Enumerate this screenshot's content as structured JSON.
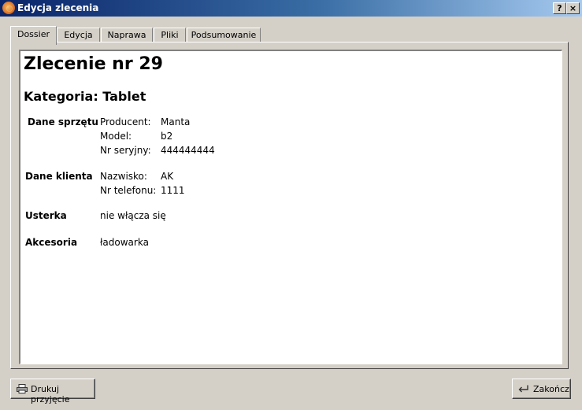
{
  "window": {
    "title": "Edycja zlecenia",
    "help_btn": "?",
    "close_btn": "×"
  },
  "tabs": [
    {
      "label": "Dossier"
    },
    {
      "label": "Edycja"
    },
    {
      "label": "Naprawa"
    },
    {
      "label": "Pliki"
    },
    {
      "label": "Podsumowanie"
    }
  ],
  "dossier": {
    "heading": "Zlecenie nr 29",
    "category": "Kategoria: Tablet",
    "sections": [
      {
        "title": "Dane sprzętu",
        "rows": [
          {
            "label": "Producent:",
            "value": "Manta"
          },
          {
            "label": "Model:",
            "value": "b2"
          },
          {
            "label": "Nr seryjny:",
            "value": "444444444"
          }
        ]
      },
      {
        "title": "Dane klienta",
        "rows": [
          {
            "label": "Nazwisko:",
            "value": "AK"
          },
          {
            "label": "Nr telefonu:",
            "value": "1111"
          }
        ]
      },
      {
        "title": "Usterka",
        "value": "nie włącza się"
      },
      {
        "title": "Akcesoria",
        "value": "ładowarka"
      }
    ]
  },
  "buttons": {
    "print": "Drukuj przyjęcie",
    "finish": "Zakończ"
  }
}
